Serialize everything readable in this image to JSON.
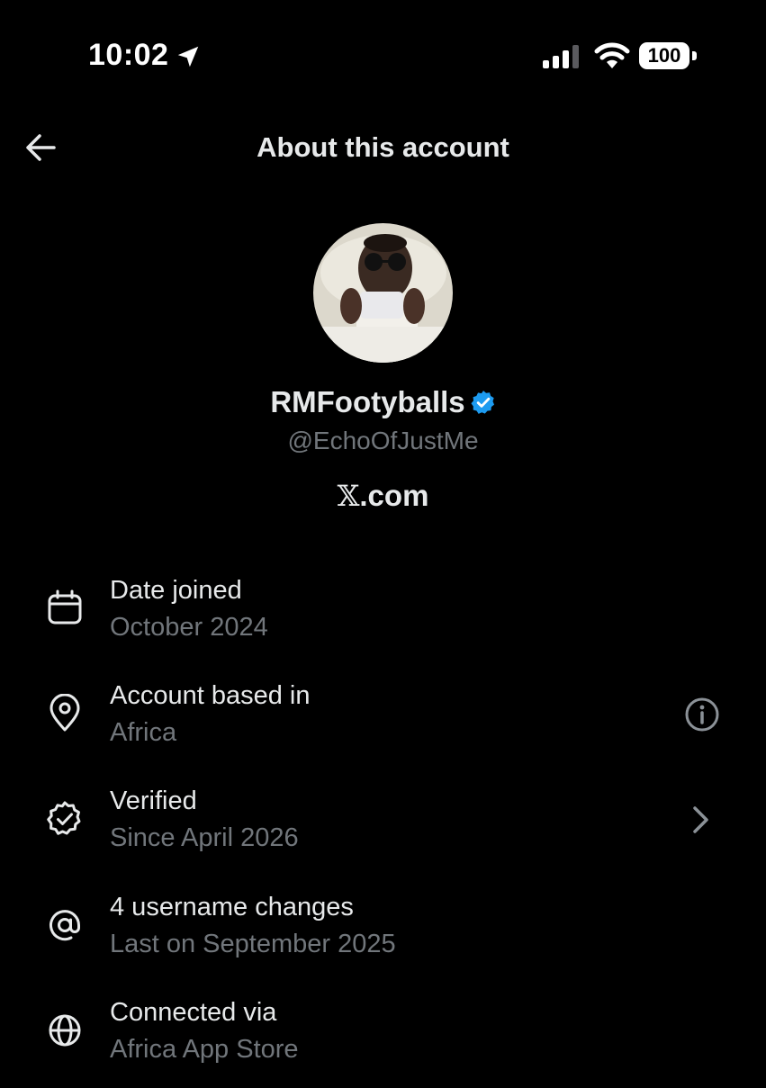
{
  "status_bar": {
    "time": "10:02",
    "battery": "100"
  },
  "header": {
    "title": "About this account"
  },
  "profile": {
    "display_name": "RMFootyballs",
    "handle": "@EchoOfJustMe",
    "site_prefix": "𝕏",
    "site_suffix": ".com",
    "verified_color": "#1d9bf0"
  },
  "rows": [
    {
      "title": "Date joined",
      "subtitle": "October 2024",
      "icon": "calendar-icon"
    },
    {
      "title": "Account based in",
      "subtitle": "Africa",
      "icon": "location-pin-icon",
      "action_icon": "info-icon"
    },
    {
      "title": "Verified",
      "subtitle": "Since April 2026",
      "icon": "verified-seal-icon",
      "action_icon": "chevron-right-icon"
    },
    {
      "title": "4 username changes",
      "subtitle": "Last on September 2025",
      "icon": "at-sign-icon"
    },
    {
      "title": "Connected via",
      "subtitle": "Africa App Store",
      "icon": "globe-icon"
    }
  ],
  "colors": {
    "background": "#000000",
    "primary_text": "#e7e9ea",
    "secondary_text": "#71767b",
    "accent": "#1d9bf0"
  }
}
